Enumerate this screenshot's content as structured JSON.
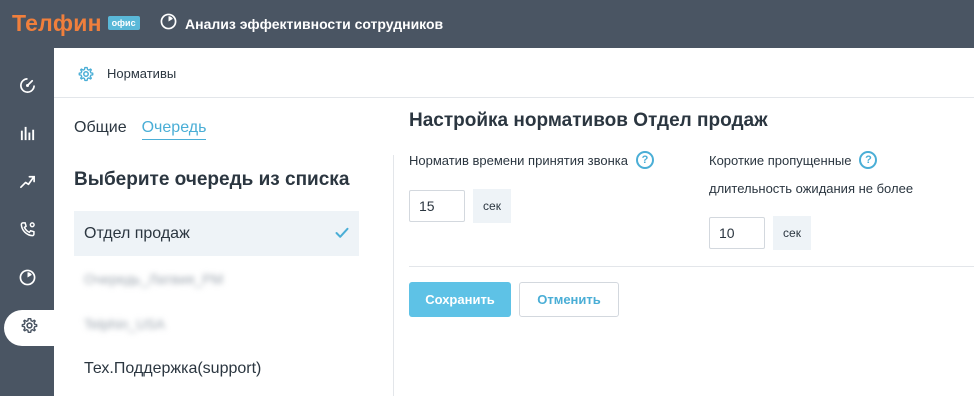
{
  "app": {
    "logo_text": "Телфин",
    "logo_badge": "офис",
    "title": "Анализ эффективности сотрудников"
  },
  "sidebar": {
    "items": [
      {
        "icon": "gauge-icon"
      },
      {
        "icon": "bar-chart-icon"
      },
      {
        "icon": "trend-icon"
      },
      {
        "icon": "phone-icon"
      },
      {
        "icon": "timer-icon"
      },
      {
        "icon": "gear-icon",
        "active": true
      }
    ]
  },
  "header": {
    "title": "Нормативы"
  },
  "tabs": [
    {
      "label": "Общие",
      "active": true
    },
    {
      "label": "Очередь",
      "active": false
    }
  ],
  "queue_panel": {
    "heading": "Выберите очередь из списка",
    "items": [
      {
        "label": "Отдел продаж",
        "selected": true
      },
      {
        "label": "Очередь_Латвия_PM",
        "blurred": true
      },
      {
        "label": "Telphin_USA",
        "blurred": true
      },
      {
        "label": "Тех.Поддержка(support)"
      }
    ]
  },
  "settings": {
    "title": "Настройка нормативов Отдел продаж",
    "answer_time": {
      "label": "Норматив времени принятия звонка",
      "value": "15",
      "unit": "сек"
    },
    "short_missed": {
      "label": "Короткие пропущенные",
      "sublabel": "длительность ожидания не более",
      "value": "10",
      "unit": "сек"
    },
    "help_glyph": "?",
    "save_label": "Сохранить",
    "cancel_label": "Отменить"
  },
  "colors": {
    "topbar": "#4a5563",
    "accent": "#4aaed6",
    "logo": "#f07f3c",
    "primary_button": "#5ec2e6"
  }
}
